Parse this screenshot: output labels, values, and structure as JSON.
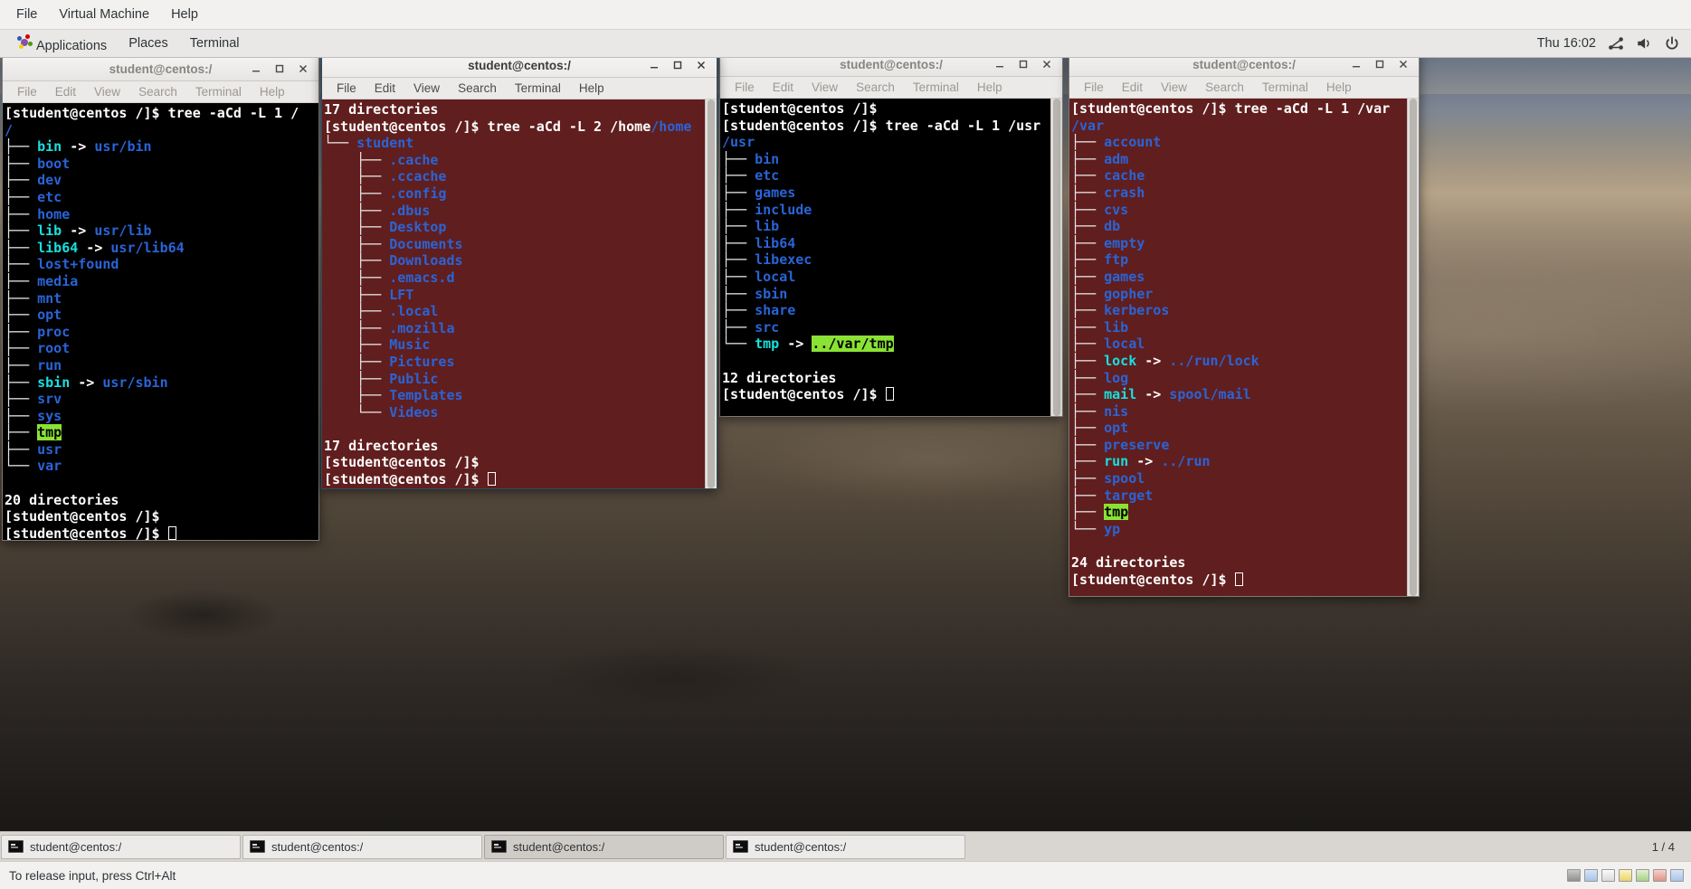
{
  "vm_menubar": {
    "items": [
      "File",
      "Virtual Machine",
      "Help"
    ]
  },
  "gnome_panel": {
    "items": [
      "Applications",
      "Places",
      "Terminal"
    ],
    "clock": "Thu 16:02",
    "tray": [
      "network-icon",
      "volume-icon",
      "power-icon"
    ]
  },
  "window_controls": {
    "minimize": "minimize-icon",
    "maximize": "maximize-icon",
    "close": "close-icon"
  },
  "menu_items": [
    "File",
    "Edit",
    "View",
    "Search",
    "Terminal",
    "Help"
  ],
  "terminals": [
    {
      "title": "student@centos:/",
      "theme": "black",
      "lines": [
        [
          {
            "t": "[student@centos /]$ tree -aCd -L 1 /",
            "c": "white"
          }
        ],
        [
          {
            "t": "/",
            "c": "blue"
          }
        ],
        [
          {
            "t": "├── ",
            "c": "tree"
          },
          {
            "t": "bin",
            "c": "cyan"
          },
          {
            "t": " -> ",
            "c": "white"
          },
          {
            "t": "usr/bin",
            "c": "blue"
          }
        ],
        [
          {
            "t": "├── ",
            "c": "tree"
          },
          {
            "t": "boot",
            "c": "blue"
          }
        ],
        [
          {
            "t": "├── ",
            "c": "tree"
          },
          {
            "t": "dev",
            "c": "blue"
          }
        ],
        [
          {
            "t": "├── ",
            "c": "tree"
          },
          {
            "t": "etc",
            "c": "blue"
          }
        ],
        [
          {
            "t": "├── ",
            "c": "tree"
          },
          {
            "t": "home",
            "c": "blue"
          }
        ],
        [
          {
            "t": "├── ",
            "c": "tree"
          },
          {
            "t": "lib",
            "c": "cyan"
          },
          {
            "t": " -> ",
            "c": "white"
          },
          {
            "t": "usr/lib",
            "c": "blue"
          }
        ],
        [
          {
            "t": "├── ",
            "c": "tree"
          },
          {
            "t": "lib64",
            "c": "cyan"
          },
          {
            "t": " -> ",
            "c": "white"
          },
          {
            "t": "usr/lib64",
            "c": "blue"
          }
        ],
        [
          {
            "t": "├── ",
            "c": "tree"
          },
          {
            "t": "lost+found",
            "c": "blue"
          }
        ],
        [
          {
            "t": "├── ",
            "c": "tree"
          },
          {
            "t": "media",
            "c": "blue"
          }
        ],
        [
          {
            "t": "├── ",
            "c": "tree"
          },
          {
            "t": "mnt",
            "c": "blue"
          }
        ],
        [
          {
            "t": "├── ",
            "c": "tree"
          },
          {
            "t": "opt",
            "c": "blue"
          }
        ],
        [
          {
            "t": "├── ",
            "c": "tree"
          },
          {
            "t": "proc",
            "c": "blue"
          }
        ],
        [
          {
            "t": "├── ",
            "c": "tree"
          },
          {
            "t": "root",
            "c": "blue"
          }
        ],
        [
          {
            "t": "├── ",
            "c": "tree"
          },
          {
            "t": "run",
            "c": "blue"
          }
        ],
        [
          {
            "t": "├── ",
            "c": "tree"
          },
          {
            "t": "sbin",
            "c": "cyan"
          },
          {
            "t": " -> ",
            "c": "white"
          },
          {
            "t": "usr/sbin",
            "c": "blue"
          }
        ],
        [
          {
            "t": "├── ",
            "c": "tree"
          },
          {
            "t": "srv",
            "c": "blue"
          }
        ],
        [
          {
            "t": "├── ",
            "c": "tree"
          },
          {
            "t": "sys",
            "c": "blue"
          }
        ],
        [
          {
            "t": "├── ",
            "c": "tree"
          },
          {
            "t": "tmp",
            "c": "hl-green"
          }
        ],
        [
          {
            "t": "├── ",
            "c": "tree"
          },
          {
            "t": "usr",
            "c": "blue"
          }
        ],
        [
          {
            "t": "└── ",
            "c": "tree"
          },
          {
            "t": "var",
            "c": "blue"
          }
        ],
        [],
        [
          {
            "t": "20 directories",
            "c": "white"
          }
        ],
        [
          {
            "t": "[student@centos /]$",
            "c": "white"
          }
        ],
        [
          {
            "t": "[student@centos /]$ ",
            "c": "white"
          },
          {
            "t": "",
            "c": "cursor"
          }
        ]
      ]
    },
    {
      "title": "student@centos:/",
      "theme": "maroon",
      "lines": [
        [
          {
            "t": "17 directories",
            "c": "white"
          }
        ],
        [
          {
            "t": "[student@centos /]$ tree -aCd -L 2 /home",
            "c": "white"
          },
          {
            "t": "/home",
            "c": "blue"
          }
        ],
        [
          {
            "t": "└── ",
            "c": "tree"
          },
          {
            "t": "student",
            "c": "blue"
          }
        ],
        [
          {
            "t": "    ├── ",
            "c": "tree"
          },
          {
            "t": ".cache",
            "c": "blue"
          }
        ],
        [
          {
            "t": "    ├── ",
            "c": "tree"
          },
          {
            "t": ".ccache",
            "c": "blue"
          }
        ],
        [
          {
            "t": "    ├── ",
            "c": "tree"
          },
          {
            "t": ".config",
            "c": "blue"
          }
        ],
        [
          {
            "t": "    ├── ",
            "c": "tree"
          },
          {
            "t": ".dbus",
            "c": "blue"
          }
        ],
        [
          {
            "t": "    ├── ",
            "c": "tree"
          },
          {
            "t": "Desktop",
            "c": "blue"
          }
        ],
        [
          {
            "t": "    ├── ",
            "c": "tree"
          },
          {
            "t": "Documents",
            "c": "blue"
          }
        ],
        [
          {
            "t": "    ├── ",
            "c": "tree"
          },
          {
            "t": "Downloads",
            "c": "blue"
          }
        ],
        [
          {
            "t": "    ├── ",
            "c": "tree"
          },
          {
            "t": ".emacs.d",
            "c": "blue"
          }
        ],
        [
          {
            "t": "    ├── ",
            "c": "tree"
          },
          {
            "t": "LFT",
            "c": "blue"
          }
        ],
        [
          {
            "t": "    ├── ",
            "c": "tree"
          },
          {
            "t": ".local",
            "c": "blue"
          }
        ],
        [
          {
            "t": "    ├── ",
            "c": "tree"
          },
          {
            "t": ".mozilla",
            "c": "blue"
          }
        ],
        [
          {
            "t": "    ├── ",
            "c": "tree"
          },
          {
            "t": "Music",
            "c": "blue"
          }
        ],
        [
          {
            "t": "    ├── ",
            "c": "tree"
          },
          {
            "t": "Pictures",
            "c": "blue"
          }
        ],
        [
          {
            "t": "    ├── ",
            "c": "tree"
          },
          {
            "t": "Public",
            "c": "blue"
          }
        ],
        [
          {
            "t": "    ├── ",
            "c": "tree"
          },
          {
            "t": "Templates",
            "c": "blue"
          }
        ],
        [
          {
            "t": "    └── ",
            "c": "tree"
          },
          {
            "t": "Videos",
            "c": "blue"
          }
        ],
        [],
        [
          {
            "t": "17 directories",
            "c": "white"
          }
        ],
        [
          {
            "t": "[student@centos /]$",
            "c": "white"
          }
        ],
        [
          {
            "t": "[student@centos /]$ ",
            "c": "white"
          },
          {
            "t": "",
            "c": "cursor"
          }
        ]
      ]
    },
    {
      "title": "student@centos:/",
      "theme": "black",
      "lines": [
        [
          {
            "t": "[student@centos /]$",
            "c": "white"
          }
        ],
        [
          {
            "t": "[student@centos /]$ tree -aCd -L 1 /usr",
            "c": "white"
          }
        ],
        [
          {
            "t": "/usr",
            "c": "blue"
          }
        ],
        [
          {
            "t": "├── ",
            "c": "tree"
          },
          {
            "t": "bin",
            "c": "blue"
          }
        ],
        [
          {
            "t": "├── ",
            "c": "tree"
          },
          {
            "t": "etc",
            "c": "blue"
          }
        ],
        [
          {
            "t": "├── ",
            "c": "tree"
          },
          {
            "t": "games",
            "c": "blue"
          }
        ],
        [
          {
            "t": "├── ",
            "c": "tree"
          },
          {
            "t": "include",
            "c": "blue"
          }
        ],
        [
          {
            "t": "├── ",
            "c": "tree"
          },
          {
            "t": "lib",
            "c": "blue"
          }
        ],
        [
          {
            "t": "├── ",
            "c": "tree"
          },
          {
            "t": "lib64",
            "c": "blue"
          }
        ],
        [
          {
            "t": "├── ",
            "c": "tree"
          },
          {
            "t": "libexec",
            "c": "blue"
          }
        ],
        [
          {
            "t": "├── ",
            "c": "tree"
          },
          {
            "t": "local",
            "c": "blue"
          }
        ],
        [
          {
            "t": "├── ",
            "c": "tree"
          },
          {
            "t": "sbin",
            "c": "blue"
          }
        ],
        [
          {
            "t": "├── ",
            "c": "tree"
          },
          {
            "t": "share",
            "c": "blue"
          }
        ],
        [
          {
            "t": "├── ",
            "c": "tree"
          },
          {
            "t": "src",
            "c": "blue"
          }
        ],
        [
          {
            "t": "└── ",
            "c": "tree"
          },
          {
            "t": "tmp",
            "c": "cyan"
          },
          {
            "t": " -> ",
            "c": "white"
          },
          {
            "t": "../var/tmp",
            "c": "hl-green"
          }
        ],
        [],
        [
          {
            "t": "12 directories",
            "c": "white"
          }
        ],
        [
          {
            "t": "[student@centos /]$ ",
            "c": "white"
          },
          {
            "t": "",
            "c": "cursor"
          }
        ]
      ]
    },
    {
      "title": "student@centos:/",
      "theme": "maroon",
      "lines": [
        [
          {
            "t": "[student@centos /]$ tree -aCd -L 1 /var",
            "c": "white"
          }
        ],
        [
          {
            "t": "/var",
            "c": "blue"
          }
        ],
        [
          {
            "t": "├── ",
            "c": "tree"
          },
          {
            "t": "account",
            "c": "blue"
          }
        ],
        [
          {
            "t": "├── ",
            "c": "tree"
          },
          {
            "t": "adm",
            "c": "blue"
          }
        ],
        [
          {
            "t": "├── ",
            "c": "tree"
          },
          {
            "t": "cache",
            "c": "blue"
          }
        ],
        [
          {
            "t": "├── ",
            "c": "tree"
          },
          {
            "t": "crash",
            "c": "blue"
          }
        ],
        [
          {
            "t": "├── ",
            "c": "tree"
          },
          {
            "t": "cvs",
            "c": "blue"
          }
        ],
        [
          {
            "t": "├── ",
            "c": "tree"
          },
          {
            "t": "db",
            "c": "blue"
          }
        ],
        [
          {
            "t": "├── ",
            "c": "tree"
          },
          {
            "t": "empty",
            "c": "blue"
          }
        ],
        [
          {
            "t": "├── ",
            "c": "tree"
          },
          {
            "t": "ftp",
            "c": "blue"
          }
        ],
        [
          {
            "t": "├── ",
            "c": "tree"
          },
          {
            "t": "games",
            "c": "blue"
          }
        ],
        [
          {
            "t": "├── ",
            "c": "tree"
          },
          {
            "t": "gopher",
            "c": "blue"
          }
        ],
        [
          {
            "t": "├── ",
            "c": "tree"
          },
          {
            "t": "kerberos",
            "c": "blue"
          }
        ],
        [
          {
            "t": "├── ",
            "c": "tree"
          },
          {
            "t": "lib",
            "c": "blue"
          }
        ],
        [
          {
            "t": "├── ",
            "c": "tree"
          },
          {
            "t": "local",
            "c": "blue"
          }
        ],
        [
          {
            "t": "├── ",
            "c": "tree"
          },
          {
            "t": "lock",
            "c": "cyan"
          },
          {
            "t": " -> ",
            "c": "white"
          },
          {
            "t": "../run/lock",
            "c": "blue"
          }
        ],
        [
          {
            "t": "├── ",
            "c": "tree"
          },
          {
            "t": "log",
            "c": "blue"
          }
        ],
        [
          {
            "t": "├── ",
            "c": "tree"
          },
          {
            "t": "mail",
            "c": "cyan"
          },
          {
            "t": " -> ",
            "c": "white"
          },
          {
            "t": "spool/mail",
            "c": "blue"
          }
        ],
        [
          {
            "t": "├── ",
            "c": "tree"
          },
          {
            "t": "nis",
            "c": "blue"
          }
        ],
        [
          {
            "t": "├── ",
            "c": "tree"
          },
          {
            "t": "opt",
            "c": "blue"
          }
        ],
        [
          {
            "t": "├── ",
            "c": "tree"
          },
          {
            "t": "preserve",
            "c": "blue"
          }
        ],
        [
          {
            "t": "├── ",
            "c": "tree"
          },
          {
            "t": "run",
            "c": "cyan"
          },
          {
            "t": " -> ",
            "c": "white"
          },
          {
            "t": "../run",
            "c": "blue"
          }
        ],
        [
          {
            "t": "├── ",
            "c": "tree"
          },
          {
            "t": "spool",
            "c": "blue"
          }
        ],
        [
          {
            "t": "├── ",
            "c": "tree"
          },
          {
            "t": "target",
            "c": "blue"
          }
        ],
        [
          {
            "t": "├── ",
            "c": "tree"
          },
          {
            "t": "tmp",
            "c": "hl-green"
          }
        ],
        [
          {
            "t": "└── ",
            "c": "tree"
          },
          {
            "t": "yp",
            "c": "blue"
          }
        ],
        [],
        [
          {
            "t": "24 directories",
            "c": "white"
          }
        ],
        [
          {
            "t": "[student@centos /]$ ",
            "c": "white"
          },
          {
            "t": "",
            "c": "cursor"
          }
        ]
      ]
    }
  ],
  "taskbar": {
    "buttons": [
      {
        "label": "student@centos:/",
        "active": false
      },
      {
        "label": "student@centos:/",
        "active": false
      },
      {
        "label": "student@centos:/",
        "active": true
      },
      {
        "label": "student@centos:/",
        "active": false
      }
    ],
    "workspace": "1 / 4"
  },
  "statusbar": {
    "message": "To release input, press Ctrl+Alt"
  }
}
